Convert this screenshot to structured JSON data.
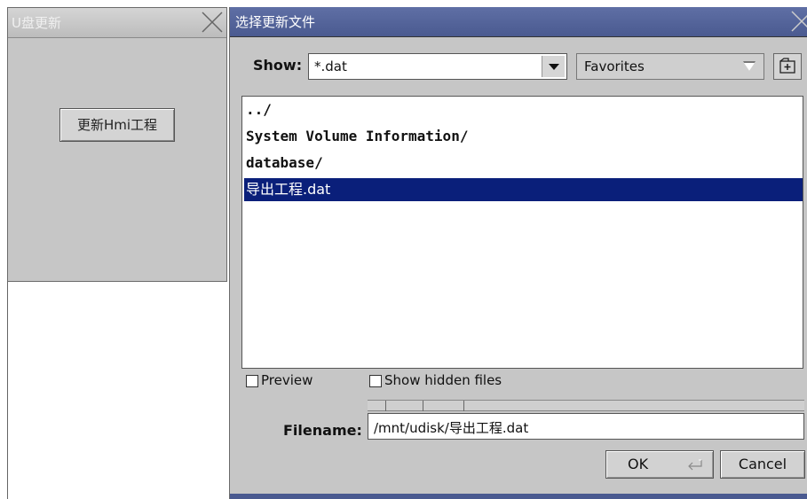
{
  "left_window": {
    "title": "U盘更新",
    "button_label": "更新Hmi工程"
  },
  "dialog": {
    "title": "选择更新文件",
    "show_label": "Show:",
    "filter_value": "*.dat",
    "favorites_label": "Favorites",
    "files": [
      {
        "name": "../",
        "type": "dir"
      },
      {
        "name": "System Volume Information/",
        "type": "dir"
      },
      {
        "name": "database/",
        "type": "dir"
      },
      {
        "name": "导出工程.dat",
        "type": "file",
        "selected": true
      }
    ],
    "preview_label": "Preview",
    "show_hidden_label": "Show hidden files",
    "filename_label": "Filename:",
    "filename_value": "/mnt/udisk/导出工程.dat",
    "ok_label": "OK",
    "cancel_label": "Cancel"
  },
  "colors": {
    "selection": "#0a1f7a",
    "titlebar_active": "#4a5a90",
    "window_bg": "#c6c6c6"
  }
}
